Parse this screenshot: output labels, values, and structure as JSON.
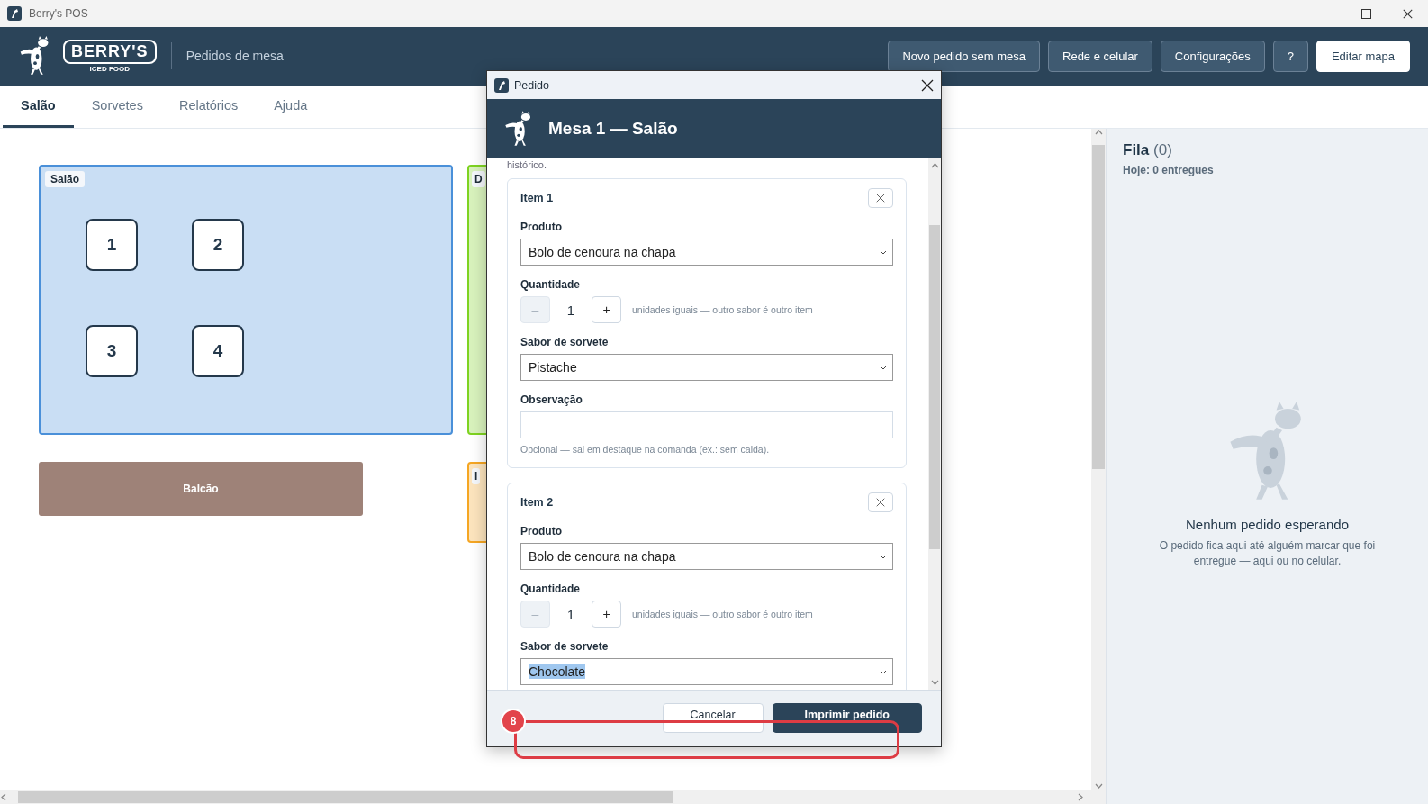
{
  "window": {
    "title": "Berry's POS"
  },
  "header": {
    "logo_text": "BERRY'S",
    "logo_subtitle": "ICED FOOD",
    "section": "Pedidos de mesa",
    "buttons": [
      {
        "label": "Novo pedido sem mesa",
        "kind": "outline"
      },
      {
        "label": "Rede e celular",
        "kind": "outline"
      },
      {
        "label": "Configurações",
        "kind": "outline"
      },
      {
        "label": "?",
        "kind": "outline"
      },
      {
        "label": "Editar mapa",
        "kind": "primary"
      }
    ]
  },
  "tabs": [
    {
      "label": "Salão",
      "selected": true
    },
    {
      "label": "Sorvetes",
      "selected": false
    },
    {
      "label": "Relatórios",
      "selected": false
    },
    {
      "label": "Ajuda",
      "selected": false
    }
  ],
  "floor_map": {
    "zones": [
      {
        "label": "Salão",
        "color": "#4a90d9",
        "tables": [
          "1",
          "2",
          "3",
          "4"
        ]
      },
      {
        "label": "D",
        "color": "#7ed321"
      },
      {
        "label": "I",
        "color": "#f5a623"
      }
    ],
    "counter": {
      "label": "Balcão"
    }
  },
  "queue": {
    "title": "Fila",
    "count": "(0)",
    "today": "Hoje: 0 entregues",
    "empty_title": "Nenhum pedido esperando",
    "empty_text": "O pedido fica aqui até alguém marcar que foi entregue — aqui ou no celular."
  },
  "dialog": {
    "title": "Pedido",
    "heading": "Mesa 1 — Salão",
    "intro_tail": "histórico.",
    "items": [
      {
        "title": "Item 1",
        "product_label": "Produto",
        "product": "Bolo de cenoura na chapa",
        "quantity_label": "Quantidade",
        "minus": "–",
        "minus_disabled": true,
        "quantity": "1",
        "plus": "+",
        "quantity_hint": "unidades iguais — outro sabor é outro item",
        "flavor_label": "Sabor de sorvete",
        "flavor": "Pistache",
        "flavor_highlighted": false,
        "note_label": "Observação",
        "note_hint": "Opcional — sai em destaque na comanda (ex.: sem calda)."
      },
      {
        "title": "Item 2",
        "product_label": "Produto",
        "product": "Bolo de cenoura na chapa",
        "quantity_label": "Quantidade",
        "minus": "–",
        "minus_disabled": true,
        "quantity": "1",
        "plus": "+",
        "quantity_hint": "unidades iguais — outro sabor é outro item",
        "flavor_label": "Sabor de sorvete",
        "flavor": "Chocolate",
        "flavor_highlighted": true
      }
    ],
    "buttons": [
      {
        "label": "Cancelar",
        "kind": "secondary"
      },
      {
        "label": "Imprimir pedido",
        "kind": "primary"
      }
    ]
  },
  "annotation": {
    "number": "8"
  }
}
